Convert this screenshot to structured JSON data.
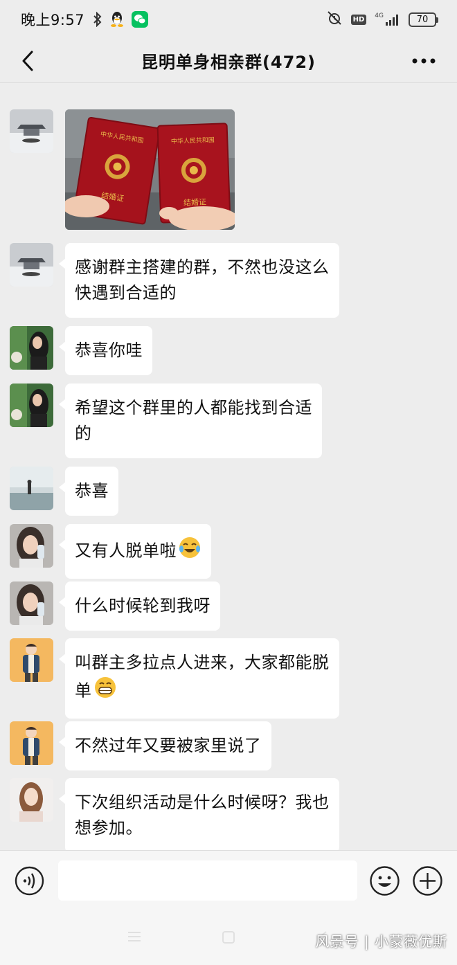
{
  "status_bar": {
    "time": "晚上9:57",
    "icons": [
      "bluetooth-icon",
      "qq-icon",
      "wechat-icon",
      "alarm-off-icon"
    ],
    "hd": "HD",
    "network": "4G",
    "battery": "70"
  },
  "header": {
    "title": "昆明单身相亲群(472)",
    "back_icon": "chevron-left-icon",
    "more_icon": "more-dots-icon"
  },
  "messages": [
    {
      "sender_avatar": "avatar-snow-house",
      "type": "image",
      "image": "marriage-certificates-photo",
      "image_text": {
        "top": "中华人民共和国",
        "bottom": "结婚证"
      }
    },
    {
      "sender_avatar": "avatar-snow-house",
      "type": "text",
      "lines": [
        "感谢群主搭建的群，不然也没这么",
        "快遇到合适的"
      ]
    },
    {
      "sender_avatar": "avatar-woman-garden",
      "type": "text",
      "lines": [
        "恭喜你哇"
      ]
    },
    {
      "sender_avatar": "avatar-woman-garden",
      "type": "text",
      "lines": [
        "希望这个群里的人都能找到合适",
        "的"
      ]
    },
    {
      "sender_avatar": "avatar-beach-figure",
      "type": "text",
      "lines": [
        "恭喜"
      ]
    },
    {
      "sender_avatar": "avatar-woman-drink",
      "type": "text",
      "lines": [
        "又有人脱单啦"
      ],
      "emoji": "crying-laughing-emoji"
    },
    {
      "sender_avatar": "avatar-woman-drink",
      "type": "text",
      "lines": [
        "什么时候轮到我呀"
      ]
    },
    {
      "sender_avatar": "avatar-cartoon-man",
      "type": "text",
      "lines": [
        "叫群主多拉点人进来，大家都能脱",
        "单"
      ],
      "emoji": "grinning-emoji"
    },
    {
      "sender_avatar": "avatar-cartoon-man",
      "type": "text",
      "lines": [
        "不然过年又要被家里说了"
      ]
    },
    {
      "sender_avatar": "avatar-woman-portrait",
      "type": "text",
      "lines": [
        "下次组织活动是什么时候呀？我也",
        "想参加。"
      ]
    }
  ],
  "input_bar": {
    "voice_icon": "voice-icon",
    "text_value": "",
    "emoji_icon": "smiley-icon",
    "plus_icon": "plus-circle-icon"
  },
  "system_nav": {
    "buttons": [
      "menu-icon",
      "home-icon",
      "back-icon"
    ],
    "watermark": "风景号 | 小蒙薇优斯"
  },
  "colors": {
    "chat_background": "#ededed",
    "bubble": "#ffffff",
    "certificate_red": "#a5121c",
    "wechat_green": "#07c160"
  }
}
